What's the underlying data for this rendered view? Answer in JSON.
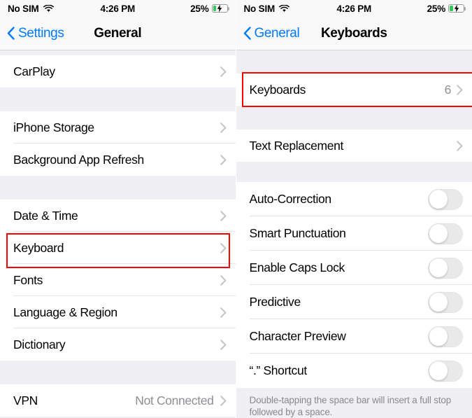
{
  "status_bar": {
    "carrier": "No SIM",
    "wifi_icon": "wifi-icon",
    "time": "4:26 PM",
    "battery_percent": "25%",
    "battery_level": 25,
    "battery_charging": true,
    "battery_color": "#34C759"
  },
  "accent_color": "#007AFF",
  "highlight_color": "#FF0000",
  "left_panel": {
    "nav": {
      "back_label": "Settings",
      "title": "General"
    },
    "groups": [
      {
        "rows": [
          {
            "label": "CarPlay",
            "accessory": "chevron",
            "value": ""
          }
        ]
      },
      {
        "rows": [
          {
            "label": "iPhone Storage",
            "accessory": "chevron",
            "value": ""
          },
          {
            "label": "Background App Refresh",
            "accessory": "chevron",
            "value": ""
          }
        ]
      },
      {
        "rows": [
          {
            "label": "Date & Time",
            "accessory": "chevron",
            "value": ""
          },
          {
            "label": "Keyboard",
            "accessory": "chevron",
            "value": "",
            "highlighted": true
          },
          {
            "label": "Fonts",
            "accessory": "chevron",
            "value": ""
          },
          {
            "label": "Language & Region",
            "accessory": "chevron",
            "value": ""
          },
          {
            "label": "Dictionary",
            "accessory": "chevron",
            "value": ""
          }
        ]
      },
      {
        "rows": [
          {
            "label": "VPN",
            "accessory": "chevron",
            "value": "Not Connected"
          }
        ]
      }
    ]
  },
  "right_panel": {
    "nav": {
      "back_label": "General",
      "title": "Keyboards"
    },
    "groups": [
      {
        "rows": [
          {
            "label": "Keyboards",
            "accessory": "chevron",
            "value": "6",
            "highlighted": true
          }
        ]
      },
      {
        "rows": [
          {
            "label": "Text Replacement",
            "accessory": "chevron",
            "value": ""
          }
        ]
      },
      {
        "rows": [
          {
            "label": "Auto-Correction",
            "accessory": "toggle",
            "toggle_on": false
          },
          {
            "label": "Smart Punctuation",
            "accessory": "toggle",
            "toggle_on": false
          },
          {
            "label": "Enable Caps Lock",
            "accessory": "toggle",
            "toggle_on": false
          },
          {
            "label": "Predictive",
            "accessory": "toggle",
            "toggle_on": false
          },
          {
            "label": "Character Preview",
            "accessory": "toggle",
            "toggle_on": false
          },
          {
            "label": "“.” Shortcut",
            "accessory": "toggle",
            "toggle_on": false
          }
        ]
      }
    ],
    "footer_note": "Double-tapping the space bar will insert a full stop followed by a space."
  }
}
